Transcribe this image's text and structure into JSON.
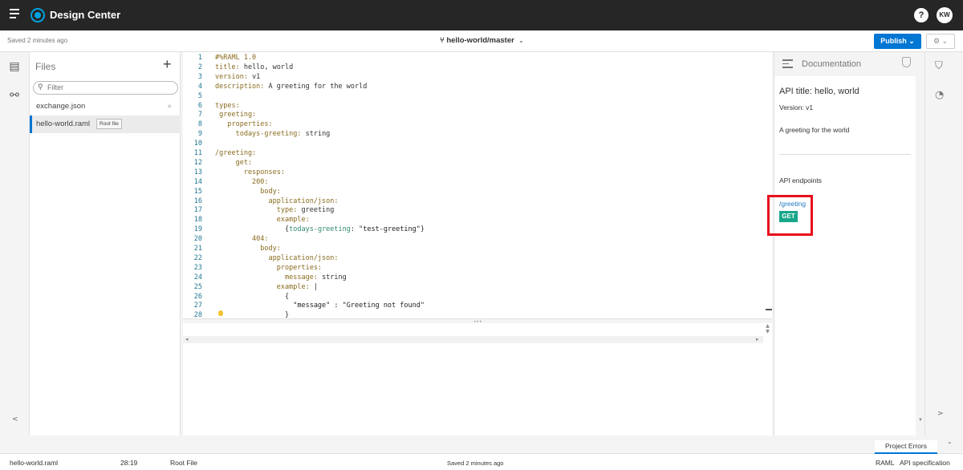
{
  "app": {
    "title": "Design Center"
  },
  "topbar": {
    "help": "?",
    "user_initials": "KW"
  },
  "subbar": {
    "saved": "Saved 2 minutes ago",
    "branch": "hello-world/master",
    "publish": "Publish ⌄",
    "settings": "⚙ ⌄"
  },
  "files": {
    "title": "Files",
    "add": "+",
    "filter_placeholder": "Filter",
    "items": [
      {
        "name": "exchange.json"
      },
      {
        "name": "hello-world.raml",
        "tag": "Root file"
      }
    ]
  },
  "editor": {
    "lines": [
      {
        "n": "1",
        "segs": [
          [
            "k",
            "#%RAML 1.0"
          ]
        ]
      },
      {
        "n": "2",
        "segs": [
          [
            "k",
            "title: "
          ],
          [
            "v",
            "hello, world"
          ]
        ]
      },
      {
        "n": "3",
        "segs": [
          [
            "k",
            "version: "
          ],
          [
            "v",
            "v1"
          ]
        ]
      },
      {
        "n": "4",
        "segs": [
          [
            "k",
            "description: "
          ],
          [
            "v",
            "A greeting for the world"
          ]
        ]
      },
      {
        "n": "5",
        "segs": []
      },
      {
        "n": "6",
        "segs": [
          [
            "k",
            "types:"
          ]
        ]
      },
      {
        "n": "7",
        "segs": [
          [
            "k",
            " greeting:"
          ]
        ]
      },
      {
        "n": "8",
        "segs": [
          [
            "k",
            "   properties:"
          ]
        ]
      },
      {
        "n": "9",
        "segs": [
          [
            "k",
            "     todays-greeting: "
          ],
          [
            "v",
            "string"
          ]
        ]
      },
      {
        "n": "10",
        "segs": []
      },
      {
        "n": "11",
        "segs": [
          [
            "k",
            "/greeting:"
          ]
        ]
      },
      {
        "n": "12",
        "segs": [
          [
            "k",
            "     get:"
          ]
        ]
      },
      {
        "n": "13",
        "segs": [
          [
            "k",
            "       responses:"
          ]
        ]
      },
      {
        "n": "14",
        "segs": [
          [
            "k",
            "         200:"
          ]
        ]
      },
      {
        "n": "15",
        "segs": [
          [
            "k",
            "           body:"
          ]
        ]
      },
      {
        "n": "16",
        "segs": [
          [
            "k",
            "             application/json:"
          ]
        ]
      },
      {
        "n": "17",
        "segs": [
          [
            "k",
            "               type: "
          ],
          [
            "v",
            "greeting"
          ]
        ]
      },
      {
        "n": "18",
        "segs": [
          [
            "k",
            "               example:"
          ]
        ]
      },
      {
        "n": "19",
        "segs": [
          [
            "v",
            "                 {"
          ],
          [
            "c",
            "todays-greeting"
          ],
          [
            "v",
            ": "
          ],
          [
            "s",
            "\"test-greeting\""
          ],
          [
            "v",
            "}"
          ]
        ]
      },
      {
        "n": "20",
        "segs": [
          [
            "k",
            "         404:"
          ]
        ]
      },
      {
        "n": "21",
        "segs": [
          [
            "k",
            "           body:"
          ]
        ]
      },
      {
        "n": "22",
        "segs": [
          [
            "k",
            "             application/json:"
          ]
        ]
      },
      {
        "n": "23",
        "segs": [
          [
            "k",
            "               properties:"
          ]
        ]
      },
      {
        "n": "24",
        "segs": [
          [
            "k",
            "                 message: "
          ],
          [
            "v",
            "string"
          ]
        ]
      },
      {
        "n": "25",
        "segs": [
          [
            "k",
            "               example: "
          ],
          [
            "v",
            "|"
          ]
        ]
      },
      {
        "n": "26",
        "segs": [
          [
            "v",
            "                 {"
          ]
        ]
      },
      {
        "n": "27",
        "segs": [
          [
            "s",
            "                   \"message\" : \"Greeting not found\""
          ]
        ]
      },
      {
        "n": "28",
        "segs": [
          [
            "v",
            "                 }"
          ]
        ]
      }
    ]
  },
  "docs": {
    "title": "Documentation",
    "api_title": "API title: hello, world",
    "version": "Version: v1",
    "description": "A greeting for the world",
    "endpoints_label": "API endpoints",
    "endpoint_path": "/greeting",
    "method": "GET"
  },
  "bottom": {
    "errors_tab": "Project Errors",
    "file": "hello-world.raml",
    "position": "28:19",
    "root": "Root File",
    "saved": "Saved 2 minutes ago",
    "lang": "RAML",
    "spec": "API specification"
  },
  "colors": {
    "accent": "#0176d3",
    "get_method": "#18a689",
    "highlight": "#e8101b",
    "topbar": "#262626"
  }
}
